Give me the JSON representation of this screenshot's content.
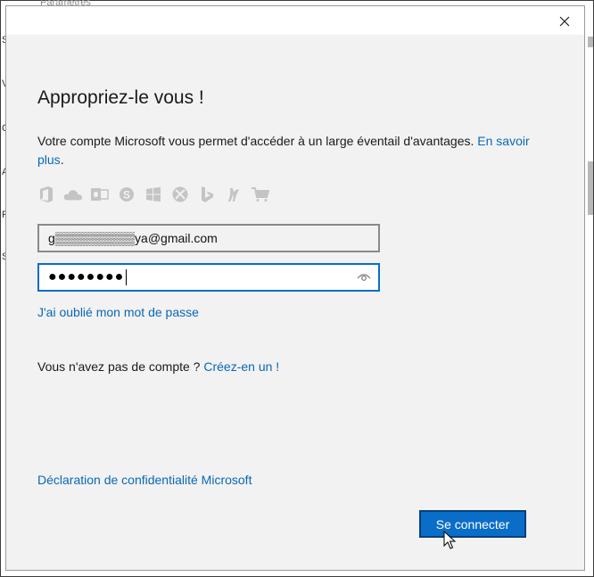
{
  "background_window": {
    "title": "Paramètres",
    "left_edge_letters": [
      "S",
      "V",
      "C",
      "A",
      "F",
      "S"
    ]
  },
  "dialog": {
    "heading": "Appropriez-le vous !",
    "description": "Votre compte Microsoft vous permet d'accéder à un large éventail d'avantages.",
    "learn_more_link": "En savoir plus",
    "description_end": ".",
    "service_icons": [
      "office-icon",
      "onedrive-icon",
      "outlook-icon",
      "skype-icon",
      "windows-icon",
      "xbox-icon",
      "bing-icon",
      "msn-icon",
      "store-icon"
    ],
    "email_field": {
      "value": "g▒▒▒▒▒▒▒▒▒ya@gmail.com"
    },
    "password_field": {
      "value": "●●●●●●●●"
    },
    "forgot_password_link": "J'ai oublié mon mot de passe",
    "no_account_text": "Vous n'avez pas de compte ?",
    "create_account_link": "Créez-en un !",
    "privacy_link": "Déclaration de confidentialité Microsoft",
    "sign_in_button": "Se connecter"
  },
  "colors": {
    "accent": "#0a6ec8",
    "link": "#0a67b7",
    "dialog_bg": "#f2f2f2"
  }
}
